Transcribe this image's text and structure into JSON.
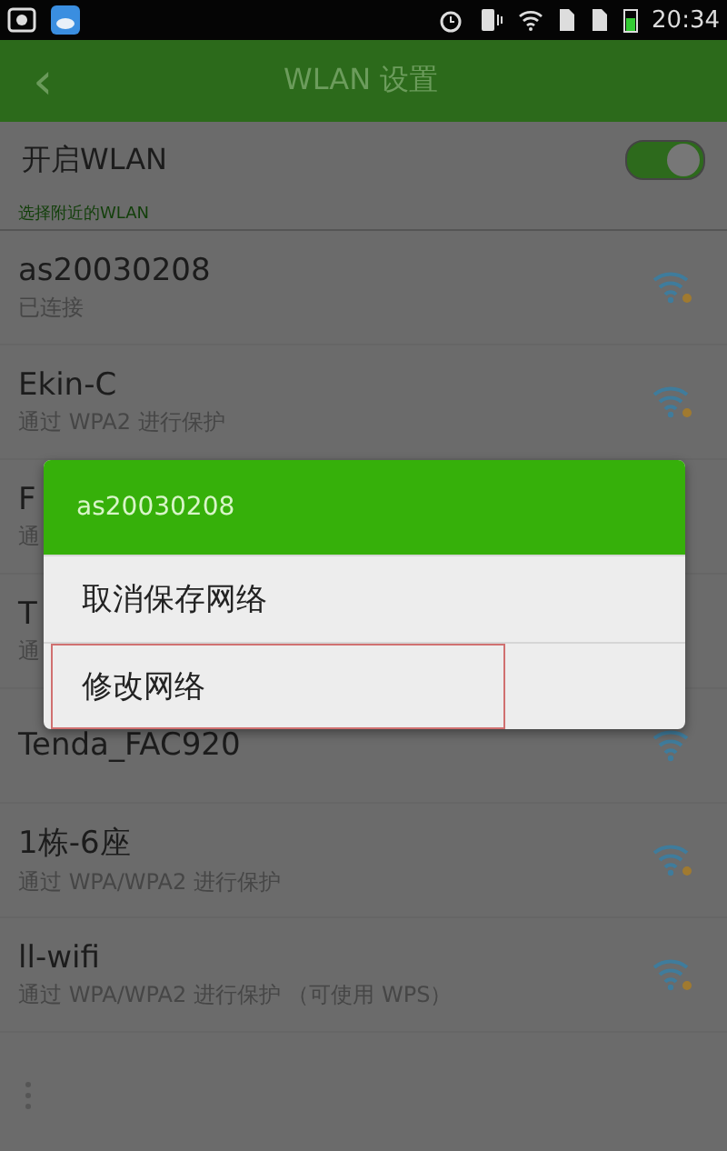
{
  "status_bar": {
    "time": "20:34"
  },
  "app_bar": {
    "back": "‹",
    "title": "WLAN 设置"
  },
  "wlan_toggle": {
    "label": "开启WLAN",
    "on": true
  },
  "section_label": "选择附近的WLAN",
  "networks": [
    {
      "name": "as20030208",
      "subtitle": "已连接",
      "secured": true
    },
    {
      "name": "Ekin-C",
      "subtitle": "通过 WPA2 进行保护",
      "secured": true
    },
    {
      "name": "F",
      "subtitle": "通"
    },
    {
      "name": "T",
      "subtitle": "通"
    },
    {
      "name": "Tenda_FAC920",
      "secured": false
    },
    {
      "name": "1栋-6座",
      "subtitle": "通过 WPA/WPA2 进行保护",
      "secured": true
    },
    {
      "name": "ll-wifi",
      "subtitle": "通过 WPA/WPA2 进行保护 （可使用 WPS）",
      "secured": true
    }
  ],
  "dialog": {
    "title": "as20030208",
    "items": [
      {
        "label": "取消保存网络",
        "highlighted": false
      },
      {
        "label": "修改网络",
        "highlighted": true
      }
    ]
  }
}
